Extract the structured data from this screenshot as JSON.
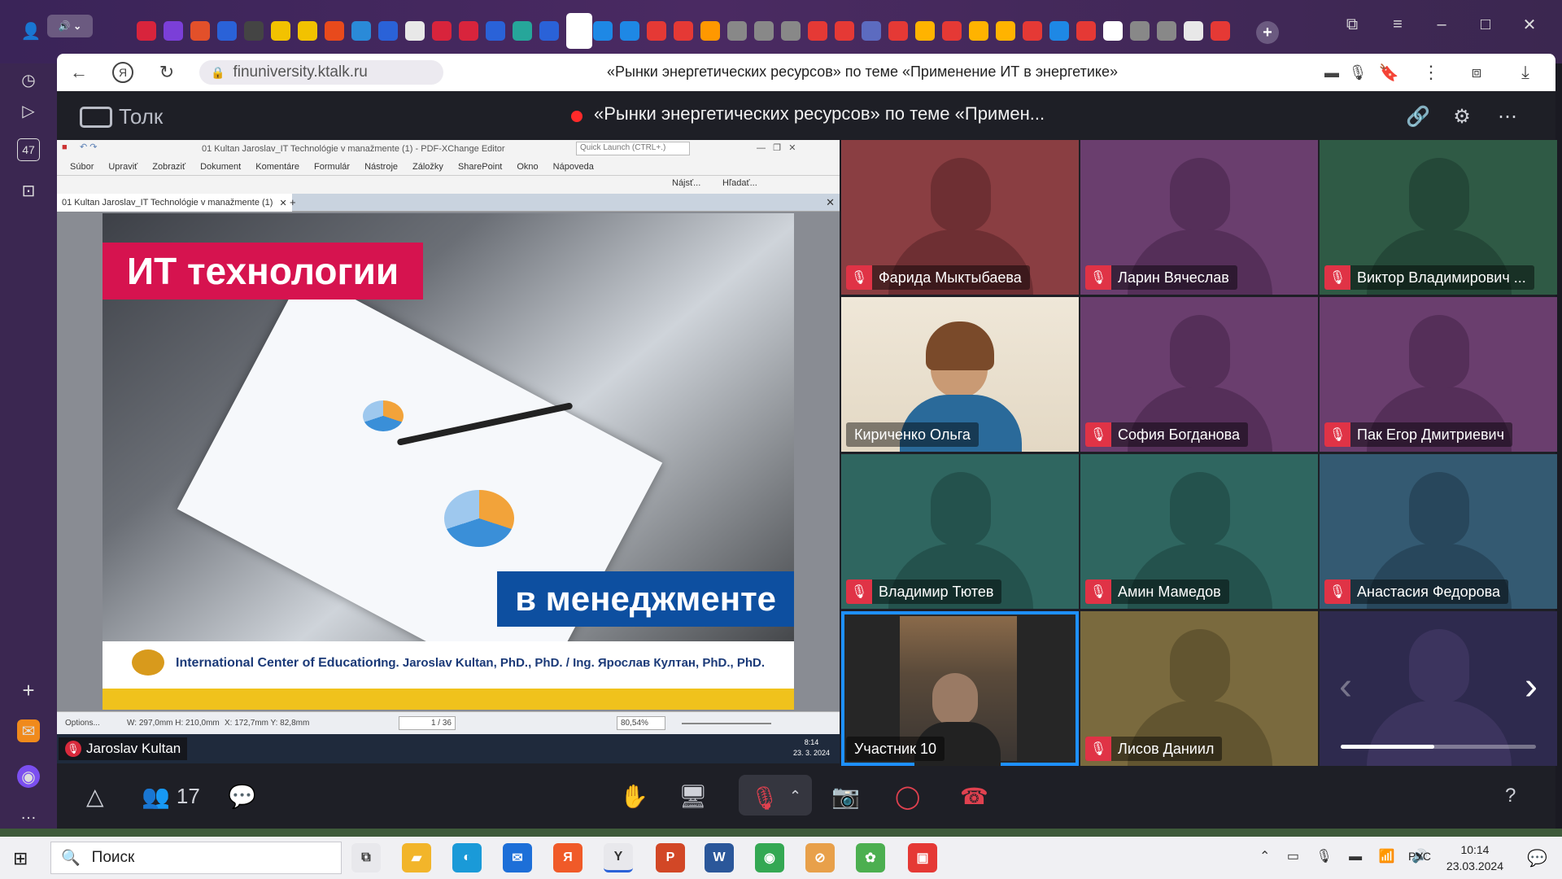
{
  "browser": {
    "url": "finuniversity.ktalk.ru",
    "page_title": "«Рынки энергетических ресурсов» по теме «Применение ИТ в энергетике»",
    "rail_badge": "47"
  },
  "meeting": {
    "app_name": "Толк",
    "title": "«Рынки энергетических ресурсов» по теме «Примен...",
    "participant_count": "17",
    "recording_color": "#ff2a2a"
  },
  "shared_screen": {
    "window_title": "01 Kultan Jaroslav_IT Technológie v manažmente (1) - PDF-XChange Editor",
    "quick_launch": "Quick Launch (CTRL+.)",
    "menu": [
      "Súbor",
      "Upraviť",
      "Zobraziť",
      "Dokument",
      "Komentáre",
      "Formulár",
      "Nástroje",
      "Záložky",
      "SharePoint",
      "Okno",
      "Nápoveda"
    ],
    "find_label": "Nájsť...",
    "search_label": "Hľadať...",
    "tab_label": "01 Kultan Jaroslav_IT Technológie v manažmente (1)",
    "slide_title_1": "ИТ технологии",
    "slide_title_2": "в менеджменте",
    "slide_org": "International Center of Education",
    "slide_author": "Ing. Jaroslav Kultan, PhD., PhD. / Ing. Ярослав Култан, PhD., PhD.",
    "status_options": "Options...",
    "status_dims": "W: 297,0mm  H: 210,0mm",
    "status_xy": "X: 172,7mm  Y: 82,8mm",
    "page_indicator": "1 / 36",
    "zoom": "80,54%",
    "inner_clock": "8:14",
    "inner_date": "23. 3. 2024",
    "presenter_name": "Jaroslav Kultan"
  },
  "participants": [
    {
      "name": "Фарида Мыктыбаева",
      "muted": true,
      "bg": "#8a3e42",
      "sil": "#6e2f33"
    },
    {
      "name": "Ларин Вячеслав",
      "muted": true,
      "bg": "#6a3e6e",
      "sil": "#552f59"
    },
    {
      "name": "Виктор Владимирович ...",
      "muted": true,
      "bg": "#2f5a45",
      "sil": "#244838"
    },
    {
      "name": "Кириченко Ольга",
      "muted": false,
      "bg": "#e8e0d2",
      "sil": ""
    },
    {
      "name": "София Богданова",
      "muted": true,
      "bg": "#6a3e6e",
      "sil": "#552f59"
    },
    {
      "name": "Пак Егор Дмитриевич",
      "muted": true,
      "bg": "#6a3e6e",
      "sil": "#552f59"
    },
    {
      "name": "Владимир Тютев",
      "muted": true,
      "bg": "#2f6660",
      "sil": "#24524d"
    },
    {
      "name": "Амин Мамедов",
      "muted": true,
      "bg": "#2f6660",
      "sil": "#24524d"
    },
    {
      "name": "Анастасия Федорова",
      "muted": true,
      "bg": "#345a72",
      "sil": "#28475c"
    },
    {
      "name": "Участник 10",
      "muted": false,
      "bg": "#262626",
      "sil": ""
    },
    {
      "name": "Лисов Даниил",
      "muted": true,
      "bg": "#7a6a3e",
      "sil": "#625530"
    },
    {
      "name": "",
      "muted": false,
      "bg": "#2e2a4e",
      "sil": "#3c345e"
    }
  ],
  "taskbar": {
    "search_placeholder": "Поиск",
    "lang": "РУС",
    "time": "10:14",
    "date": "23.03.2024"
  }
}
